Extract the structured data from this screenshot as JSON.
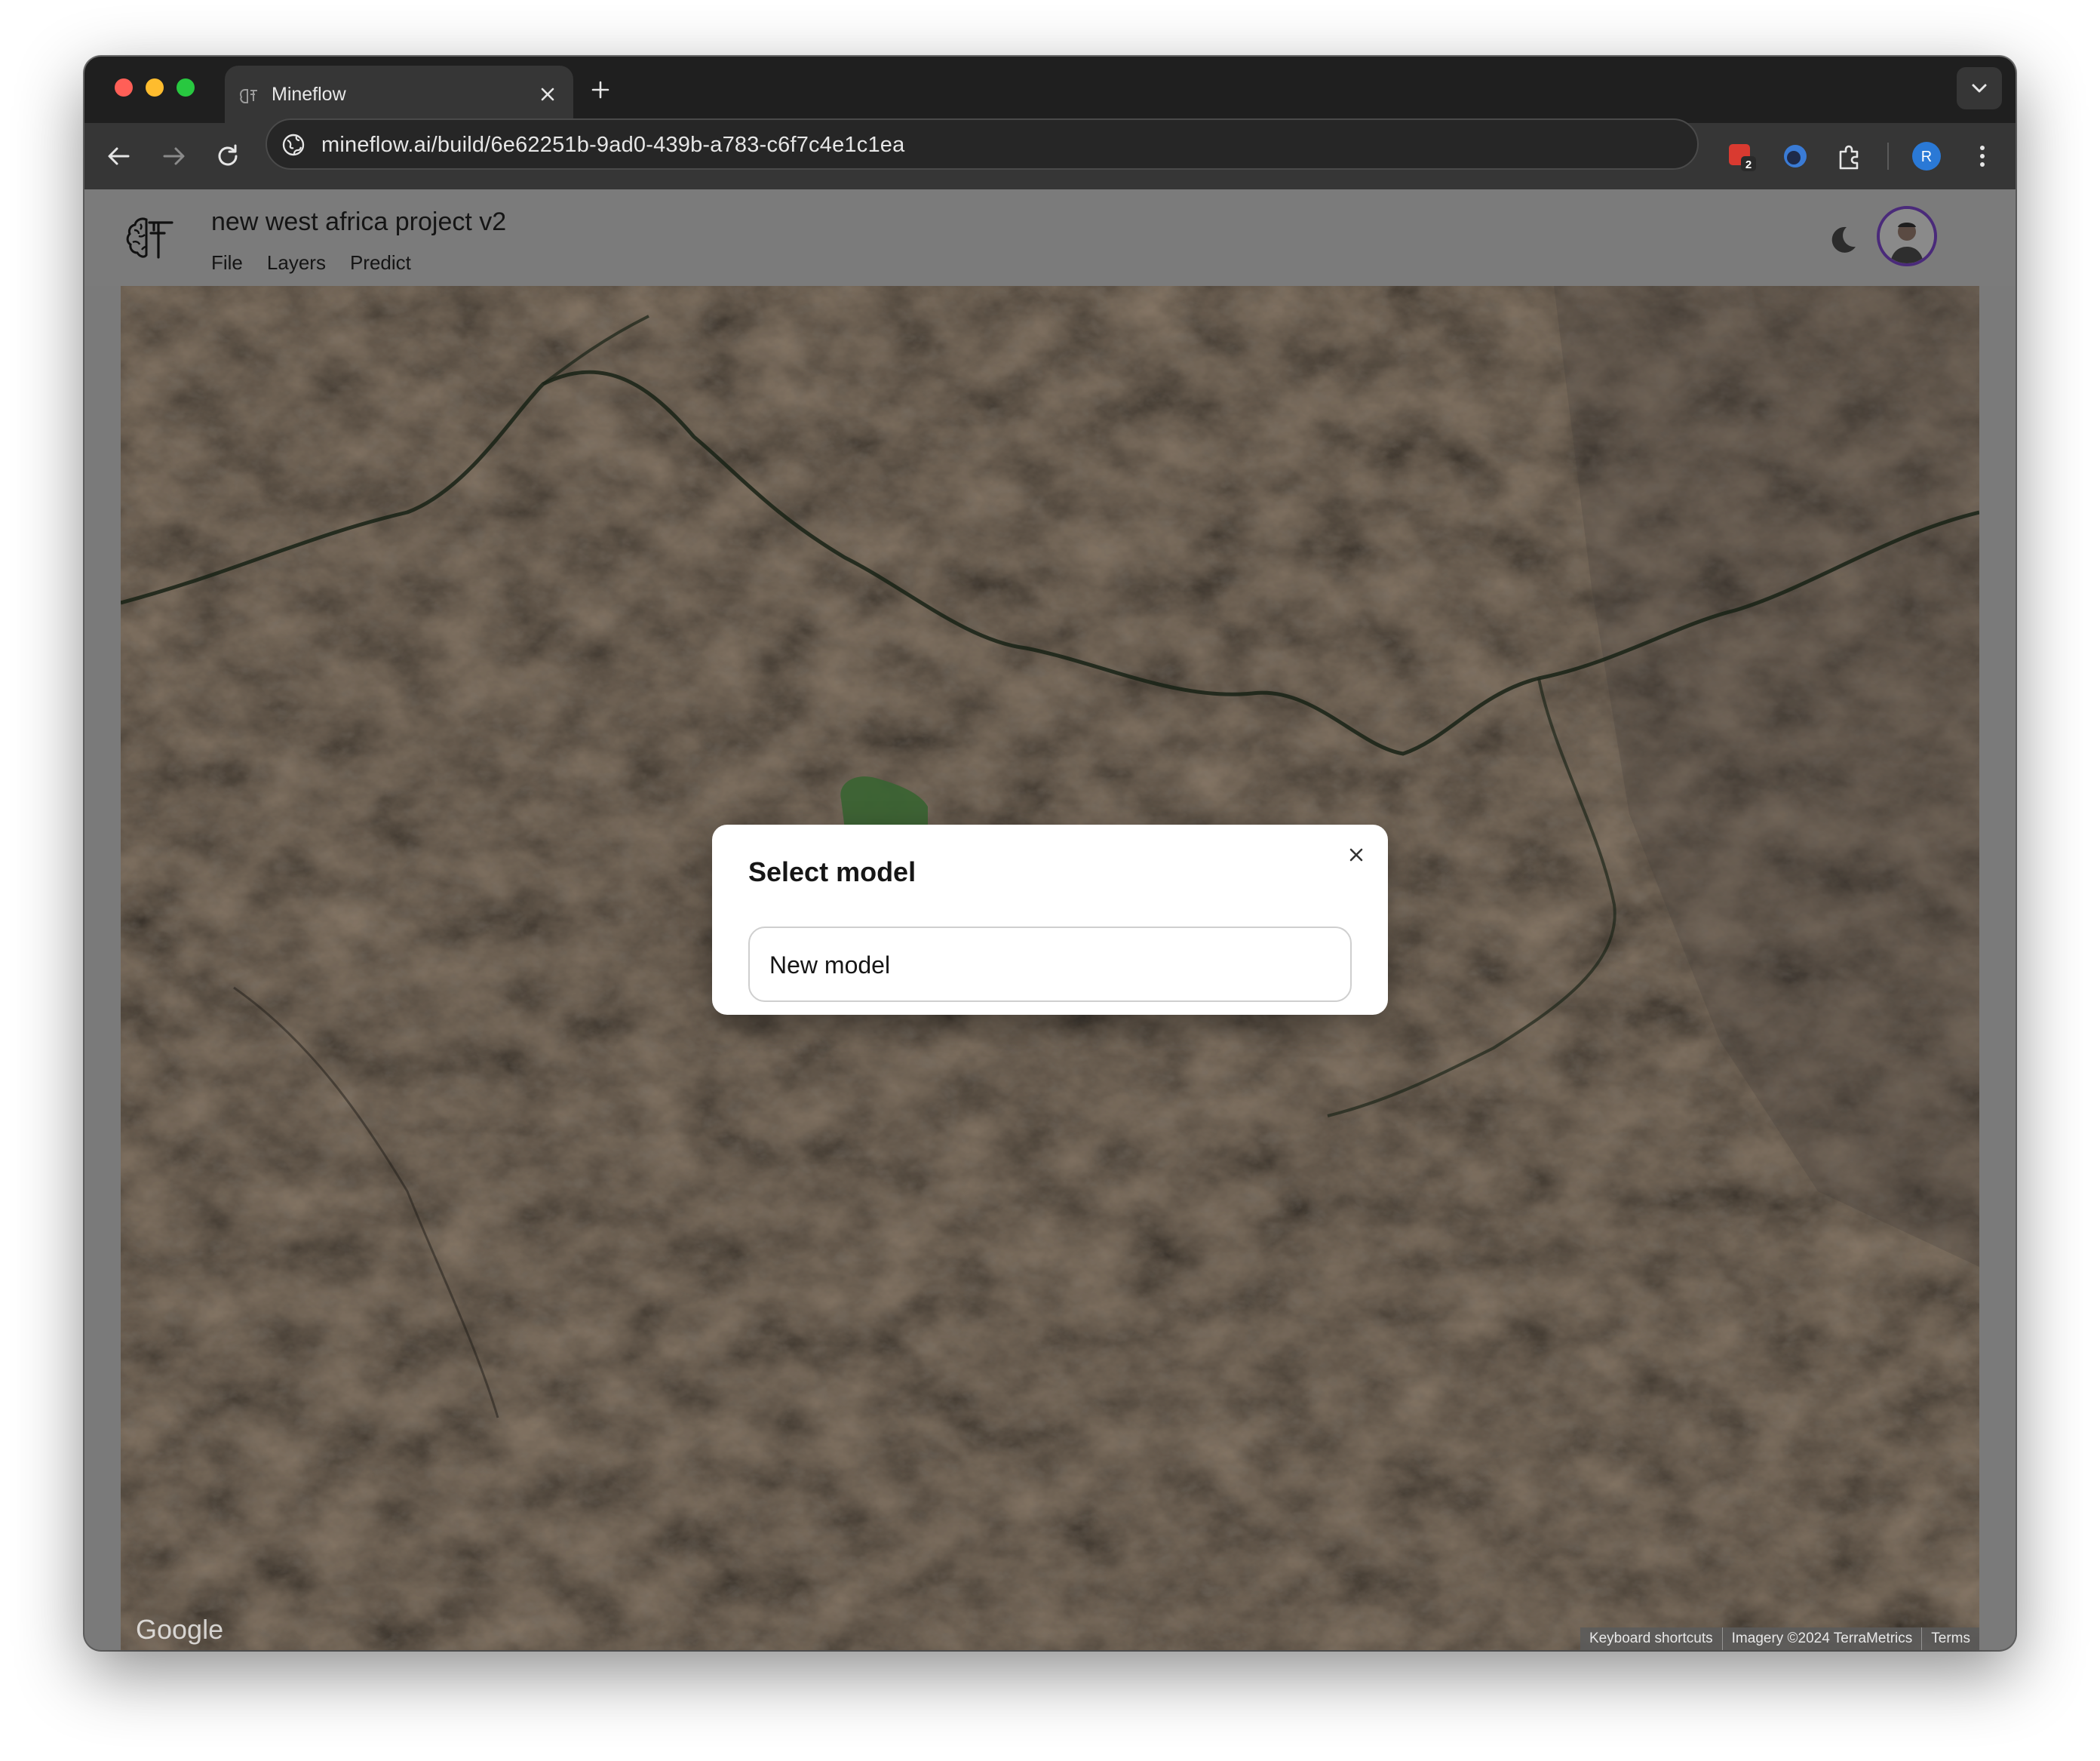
{
  "browser": {
    "tab_title": "Mineflow",
    "url": "mineflow.ai/build/6e62251b-9ad0-439b-a783-c6f7c4e1c1ea",
    "extension_badge": "2",
    "profile_initial": "R"
  },
  "app": {
    "project_title": "new west africa project v2",
    "menu": [
      "File",
      "Layers",
      "Predict"
    ]
  },
  "map": {
    "logo_text": "Google",
    "attribution": [
      "Keyboard shortcuts",
      "Imagery ©2024 TerraMetrics",
      "Terms"
    ]
  },
  "modal": {
    "title": "Select model",
    "options": [
      "New model"
    ]
  },
  "colors": {
    "overlay": "#7b7b7b",
    "map_base": "#3a3027",
    "polygon": "#4f8a45",
    "avatar_ring": "#4a2a7a"
  }
}
